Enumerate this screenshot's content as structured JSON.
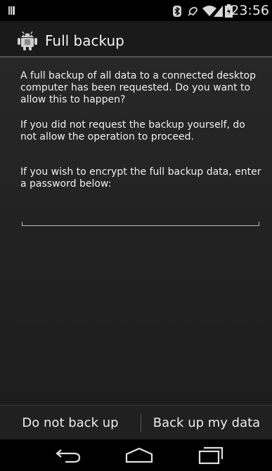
{
  "status_bar": {
    "time": "23:56",
    "icons": [
      "notification-icon",
      "bluetooth-icon",
      "alarm-icon",
      "wifi-icon",
      "signal-icon",
      "battery-icon"
    ]
  },
  "action_bar": {
    "icon": "android-robot-icon",
    "title": "Full backup"
  },
  "content": {
    "paragraph1": "A full backup of all data to a connected desktop computer has been requested. Do you want to allow this to happen?",
    "paragraph2": "If you did not request the backup yourself, do not allow the operation to proceed.",
    "paragraph3": "If you wish to encrypt the full backup data, enter a password below:",
    "password_value": ""
  },
  "buttons": {
    "deny_label": "Do not back up",
    "allow_label": "Back up my data"
  },
  "nav_bar": {
    "icons": [
      "back-icon",
      "home-icon",
      "recents-icon"
    ]
  },
  "colors": {
    "content_background": "#252525",
    "text": "#f0f0f0",
    "divider": "#555555"
  }
}
